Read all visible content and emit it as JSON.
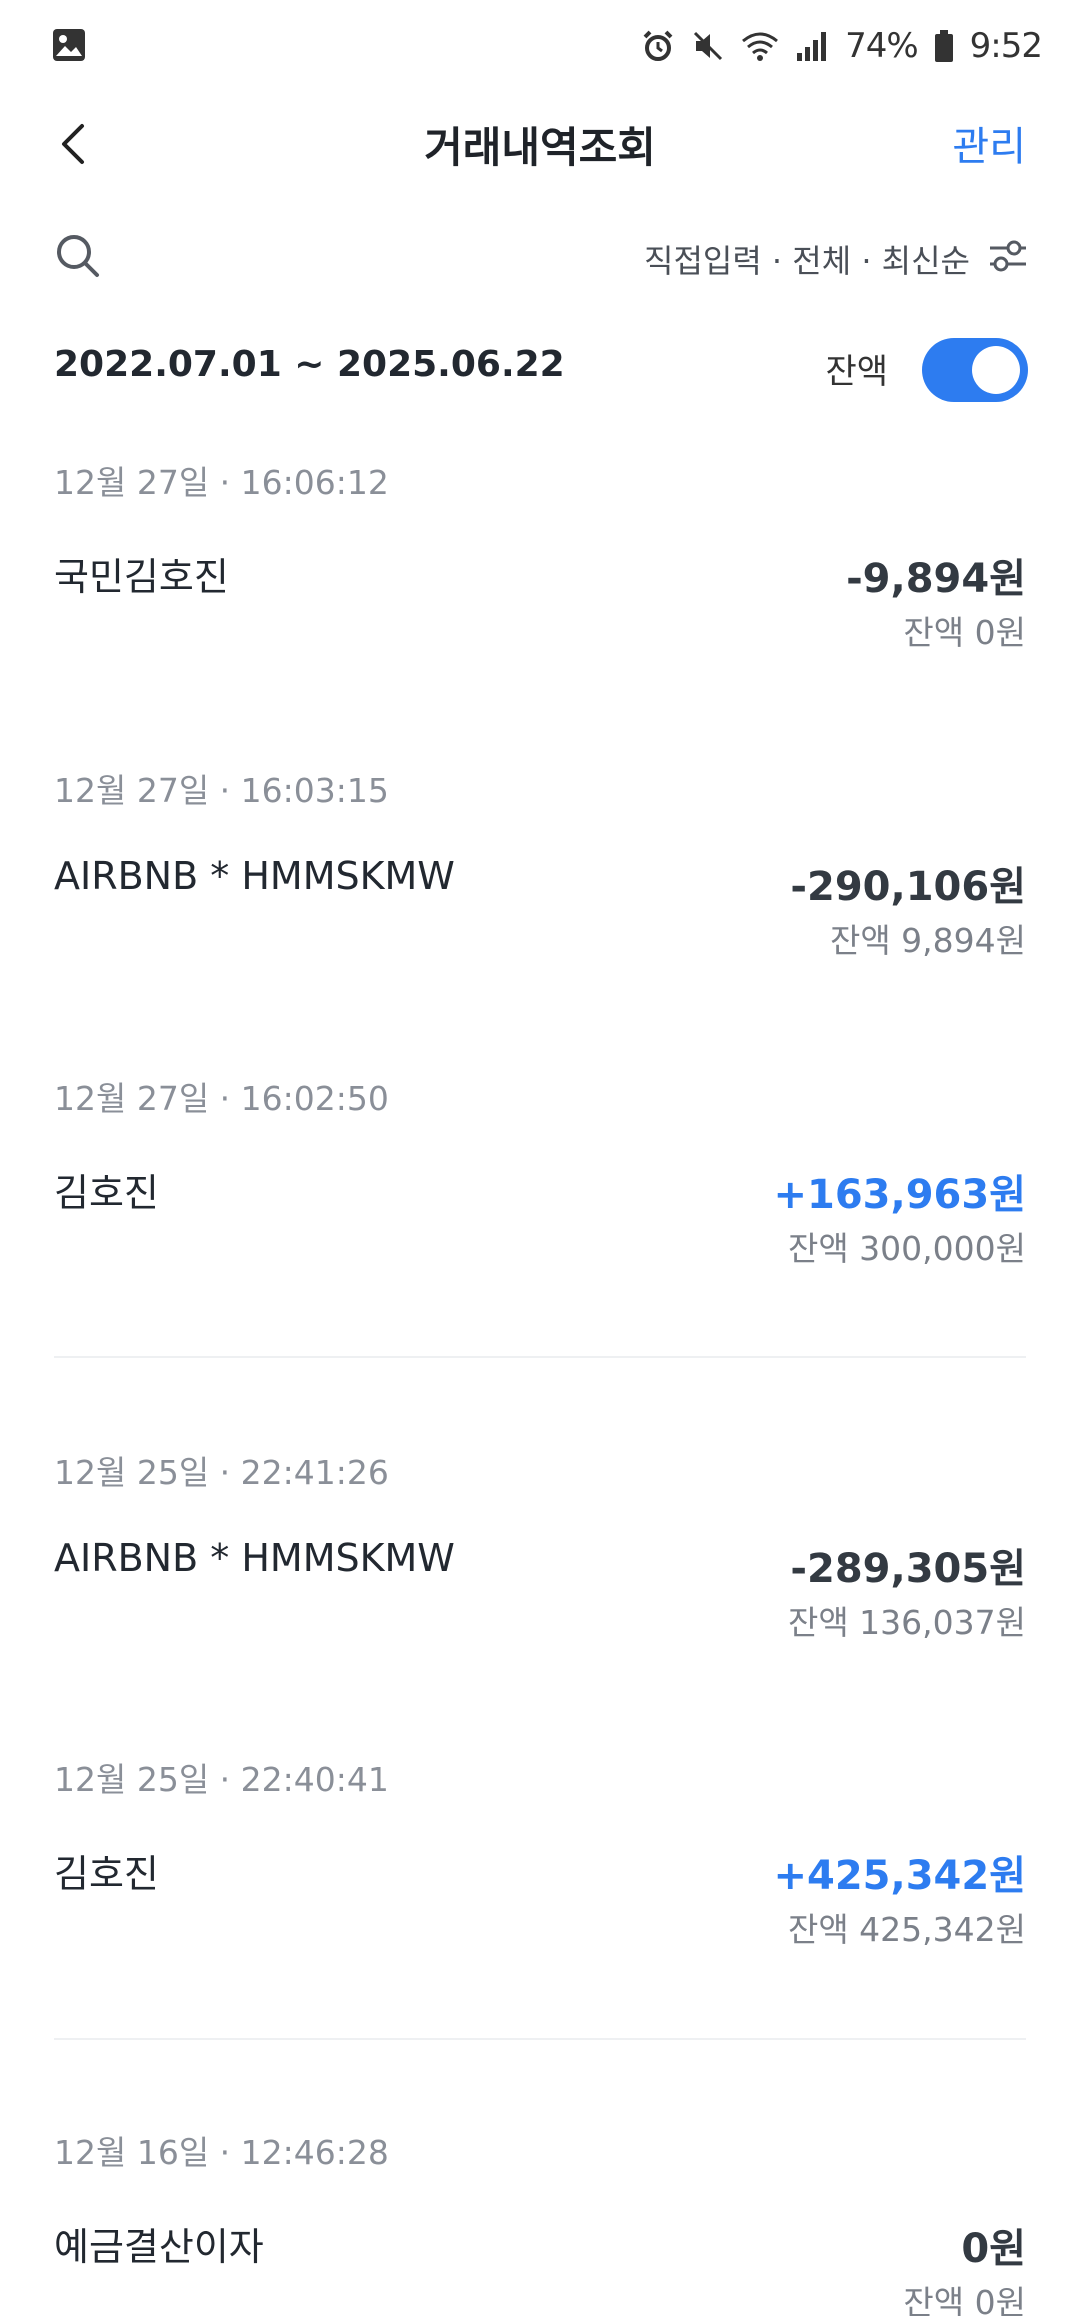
{
  "status_bar": {
    "battery": "74%",
    "time": "9:52",
    "icons": [
      "gallery-icon",
      "alarm-icon",
      "mute-icon",
      "wifi-icon",
      "signal-icon",
      "battery-icon"
    ]
  },
  "header": {
    "title": "거래내역조회",
    "manage_label": "관리"
  },
  "filter": {
    "summary": "직접입력 · 전체 · 최신순"
  },
  "range": {
    "text": "2022.07.01 ~ 2025.06.22",
    "balance_label": "잔액",
    "balance_toggle_on": true
  },
  "colors": {
    "accent": "#2d7cf0",
    "text": "#222830",
    "muted": "#8a8f98"
  },
  "transactions": [
    {
      "date": "12월 27일 · 16:06:12",
      "name": "국민김호진",
      "amount": "-9,894원",
      "balance": "잔액 0원",
      "type": "minus"
    },
    {
      "date": "12월 27일 · 16:03:15",
      "name": "AIRBNB * HMMSKMW",
      "amount": "-290,106원",
      "balance": "잔액 9,894원",
      "type": "minus"
    },
    {
      "date": "12월 27일 · 16:02:50",
      "name": "김호진",
      "amount": "+163,963원",
      "balance": "잔액 300,000원",
      "type": "plus"
    },
    {
      "date": "12월 25일 · 22:41:26",
      "name": "AIRBNB * HMMSKMW",
      "amount": "-289,305원",
      "balance": "잔액 136,037원",
      "type": "minus"
    },
    {
      "date": "12월 25일 · 22:40:41",
      "name": "김호진",
      "amount": "+425,342원",
      "balance": "잔액 425,342원",
      "type": "plus"
    },
    {
      "date": "12월 16일 · 12:46:28",
      "name": "예금결산이자",
      "amount": "0원",
      "balance": "잔액 0원",
      "type": "zero"
    }
  ]
}
